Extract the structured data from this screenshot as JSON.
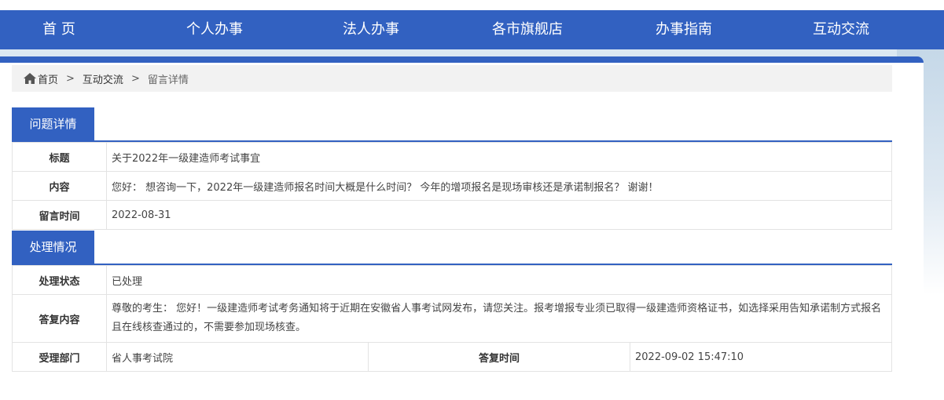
{
  "nav": {
    "items": [
      "首 页",
      "个人办事",
      "法人办事",
      "各市旗舰店",
      "办事指南",
      "互动交流"
    ]
  },
  "breadcrumb": {
    "home": "首页",
    "level1": "互动交流",
    "current": "留言详情",
    "separator": ">"
  },
  "question": {
    "section_title": "问题详情",
    "title_label": "标题",
    "title_value": "关于2022年一级建造师考试事宜",
    "content_label": "内容",
    "content_value": "您好： 想咨询一下，2022年一级建造师报名时间大概是什么时间？ 今年的增项报名是现场审核还是承诺制报名？ 谢谢！",
    "time_label": "留言时间",
    "time_value": "2022-08-31"
  },
  "handling": {
    "section_title": "处理情况",
    "status_label": "处理状态",
    "status_value": "已处理",
    "reply_label": "答复内容",
    "reply_value": "尊敬的考生： 您好！一级建造师考试考务通知将于近期在安徽省人事考试网发布，请您关注。报考增报专业须已取得一级建造师资格证书，如选择采用告知承诺制方式报名且在线核查通过的，不需要参加现场核查。",
    "dept_label": "受理部门",
    "dept_value": "省人事考试院",
    "reply_time_label": "答复时间",
    "reply_time_value": "2022-09-02 15:47:10"
  },
  "colors": {
    "brand_blue": "#3261c1",
    "breadcrumb_bg": "#f2f2f2",
    "border": "#e3e3e3"
  }
}
